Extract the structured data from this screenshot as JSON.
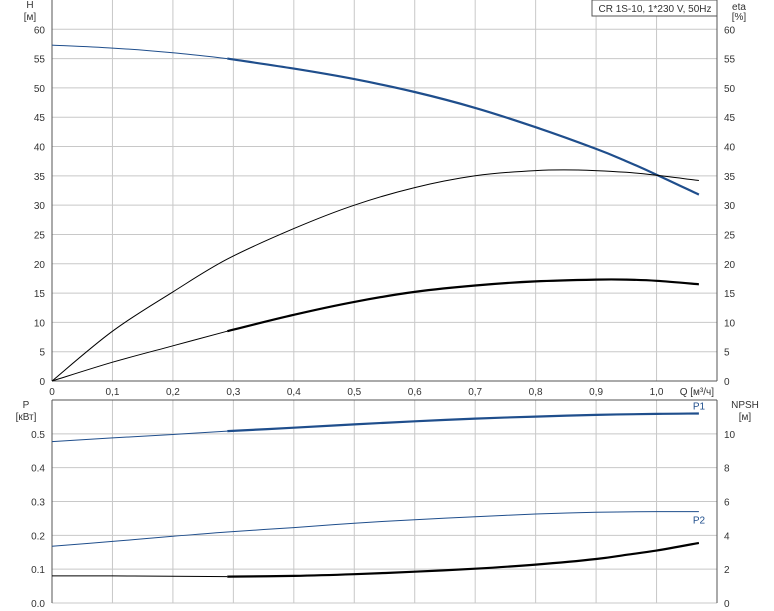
{
  "header": {
    "title": "CR 1S-10, 1*230 V, 50Hz"
  },
  "colors": {
    "blue": "#1f4e8c",
    "black": "#000000",
    "grid": "#c8c8c8"
  },
  "chart_data": [
    {
      "type": "line",
      "name": "head-efficiency",
      "grid": true,
      "xlim": [
        0,
        1.1
      ],
      "x_ticks": [
        "0",
        "0,1",
        "0,2",
        "0,3",
        "0,4",
        "0,5",
        "0,6",
        "0,7",
        "0,8",
        "0,9",
        "1,0"
      ],
      "x_tick_values": [
        0,
        0.1,
        0.2,
        0.3,
        0.4,
        0.5,
        0.6,
        0.7,
        0.8,
        0.9,
        1.0
      ],
      "xlabel": "Q [м³/ч]",
      "ylim": [
        0,
        65
      ],
      "y_ticks": [
        "0",
        "5",
        "10",
        "15",
        "20",
        "25",
        "30",
        "35",
        "40",
        "45",
        "50",
        "55",
        "60"
      ],
      "y_tick_values": [
        0,
        5,
        10,
        15,
        20,
        25,
        30,
        35,
        40,
        45,
        50,
        55,
        60
      ],
      "ylabel_left": {
        "name": "H",
        "unit": "[м]"
      },
      "ylabel_right": {
        "name": "eta",
        "unit": "[%]"
      },
      "series": [
        {
          "key": "H",
          "color": "#1f4e8c",
          "thin_until": 0.29,
          "x": [
            0,
            0.1,
            0.2,
            0.29,
            0.4,
            0.5,
            0.6,
            0.7,
            0.8,
            0.9,
            0.95,
            1.0,
            1.07
          ],
          "y": [
            57.3,
            56.8,
            56.0,
            55.0,
            53.3,
            51.5,
            49.3,
            46.6,
            43.3,
            39.6,
            37.5,
            35.2,
            31.8
          ]
        },
        {
          "key": "eta",
          "color": "#000000",
          "thin_until": 1.07,
          "x": [
            0,
            0.1,
            0.2,
            0.29,
            0.4,
            0.5,
            0.6,
            0.7,
            0.8,
            0.87,
            0.95,
            1.0,
            1.07
          ],
          "y": [
            0,
            8.5,
            15.2,
            20.8,
            26.0,
            30.0,
            33.0,
            35.0,
            35.9,
            36.0,
            35.6,
            35.1,
            34.2
          ]
        },
        {
          "key": "eta-bold",
          "color": "#000000",
          "thin_until": 0.29,
          "x": [
            0,
            0.1,
            0.2,
            0.29,
            0.4,
            0.5,
            0.6,
            0.7,
            0.8,
            0.9,
            0.95,
            1.0,
            1.07
          ],
          "y": [
            0,
            3.2,
            6.0,
            8.5,
            11.3,
            13.5,
            15.2,
            16.3,
            17.0,
            17.3,
            17.3,
            17.1,
            16.5
          ]
        }
      ]
    },
    {
      "type": "line",
      "name": "power-npsh",
      "grid": true,
      "xlim": [
        0,
        1.1
      ],
      "ylim": [
        0,
        0.6
      ],
      "y_ticks": [
        "0.0",
        "0.1",
        "0.2",
        "0.3",
        "0.4",
        "0.5"
      ],
      "y_tick_values": [
        0,
        0.1,
        0.2,
        0.3,
        0.4,
        0.5
      ],
      "y2lim": [
        0,
        12
      ],
      "y2_ticks": [
        "0",
        "2",
        "4",
        "6",
        "8",
        "10"
      ],
      "y2_tick_values": [
        0,
        2,
        4,
        6,
        8,
        10
      ],
      "ylabel_left": {
        "name": "P",
        "unit": "[кВт]"
      },
      "ylabel_right": {
        "name": "NPSH",
        "unit": "[м]"
      },
      "series": [
        {
          "name": "P1",
          "axis": "left",
          "color": "#1f4e8c",
          "thin_until": 0.29,
          "x": [
            0,
            0.1,
            0.2,
            0.29,
            0.4,
            0.5,
            0.6,
            0.7,
            0.8,
            0.9,
            1.0,
            1.07
          ],
          "y": [
            0.477,
            0.488,
            0.498,
            0.508,
            0.518,
            0.528,
            0.537,
            0.545,
            0.551,
            0.556,
            0.559,
            0.56
          ]
        },
        {
          "name": "P2",
          "axis": "left",
          "color": "#1f4e8c",
          "thin_until": 1.07,
          "x": [
            0,
            0.1,
            0.2,
            0.29,
            0.4,
            0.5,
            0.6,
            0.7,
            0.8,
            0.9,
            1.0,
            1.07
          ],
          "y": [
            0.168,
            0.182,
            0.197,
            0.21,
            0.223,
            0.236,
            0.246,
            0.255,
            0.263,
            0.268,
            0.27,
            0.27
          ]
        },
        {
          "key": "NPSH",
          "axis": "right",
          "color": "#000000",
          "thin_until": 0.29,
          "x": [
            0,
            0.1,
            0.2,
            0.29,
            0.4,
            0.5,
            0.6,
            0.7,
            0.8,
            0.9,
            0.95,
            1.0,
            1.07
          ],
          "y": [
            1.6,
            1.6,
            1.58,
            1.56,
            1.6,
            1.7,
            1.85,
            2.03,
            2.27,
            2.6,
            2.85,
            3.1,
            3.55
          ]
        }
      ]
    }
  ]
}
